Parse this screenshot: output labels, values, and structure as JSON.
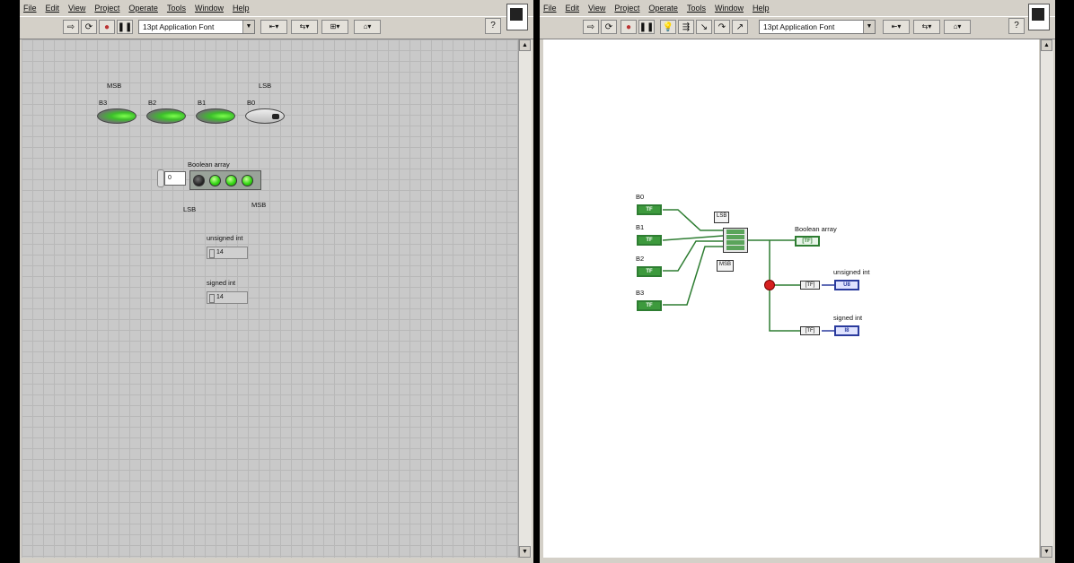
{
  "menu": [
    "File",
    "Edit",
    "View",
    "Project",
    "Operate",
    "Tools",
    "Window",
    "Help"
  ],
  "toolbar": {
    "font": "13pt Application Font"
  },
  "front_panel": {
    "msb_label": "MSB",
    "lsb_label": "LSB",
    "buttons": [
      {
        "label": "B3",
        "state": "on"
      },
      {
        "label": "B2",
        "state": "on"
      },
      {
        "label": "B1",
        "state": "on"
      },
      {
        "label": "B0",
        "state": "off"
      }
    ],
    "array": {
      "label": "Boolean array",
      "index": "0",
      "leds": [
        "off",
        "on",
        "on",
        "on"
      ],
      "lsb_label": "LSB",
      "msb_label": "MSB"
    },
    "unsigned": {
      "label": "unsigned int",
      "value": "14"
    },
    "signed": {
      "label": "signed int",
      "value": "14"
    }
  },
  "block_diagram": {
    "inputs": [
      "B0",
      "B1",
      "B2",
      "B3"
    ],
    "terminal_tf": "TF",
    "const_lsb": "LSB",
    "const_msb": "MSB",
    "array_out": {
      "label": "Boolean array",
      "terminal": "[TF]"
    },
    "unsigned_out": {
      "label": "unsigned int",
      "terminal": "U8"
    },
    "signed_out": {
      "label": "signed int",
      "terminal": "I8"
    },
    "conv_text": "[TF]"
  }
}
